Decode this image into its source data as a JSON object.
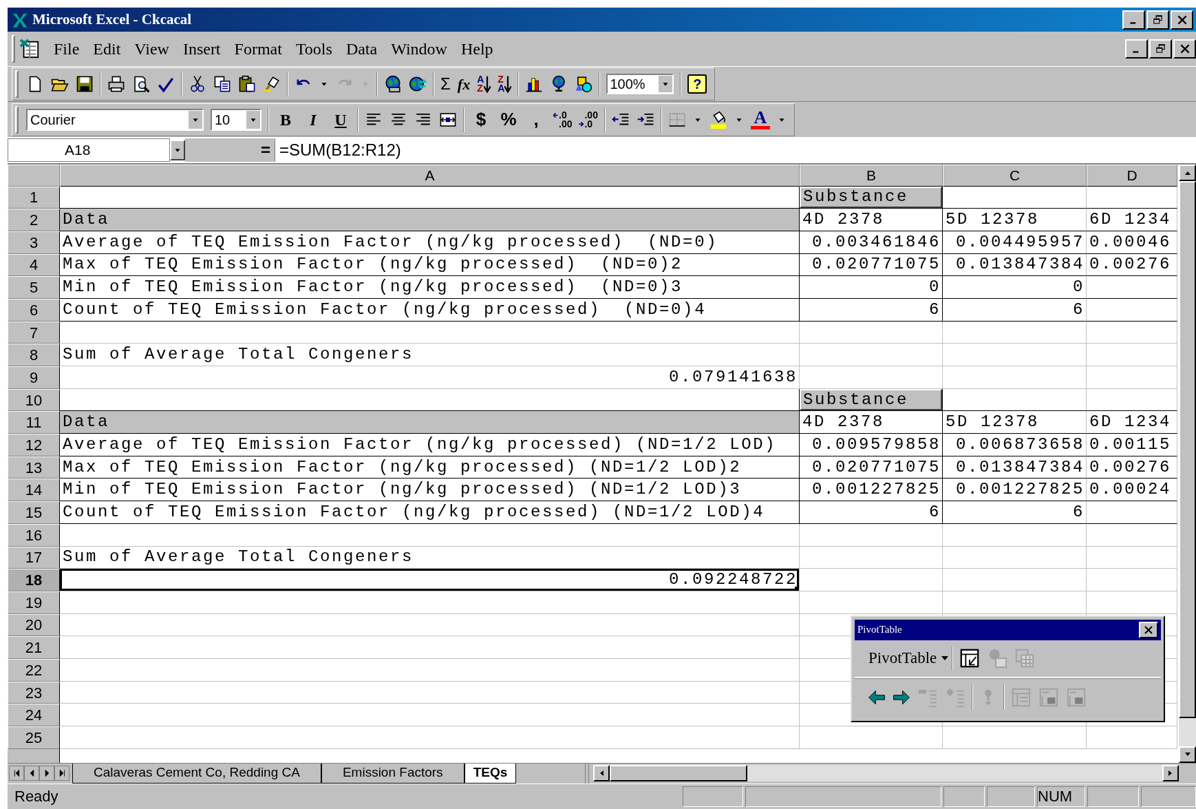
{
  "window": {
    "title": "Microsoft Excel - Ckcacal"
  },
  "menu": [
    "File",
    "Edit",
    "View",
    "Insert",
    "Format",
    "Tools",
    "Data",
    "Window",
    "Help"
  ],
  "standard_toolbar": {
    "autosum": "Σ",
    "function": "fx",
    "sort": [
      {
        "top": "A",
        "bottom": "Z"
      },
      {
        "top": "Z",
        "bottom": "A"
      }
    ],
    "zoom": "100%",
    "help": "?"
  },
  "formatting_toolbar": {
    "font": "Courier",
    "size": "10",
    "style_buttons": [
      "B",
      "I",
      "U"
    ],
    "number_buttons": [
      "$",
      "%",
      ","
    ],
    "decimal_buttons": [
      {
        "top": ".0",
        "bottom": ".00"
      },
      {
        "top": ".00",
        "bottom": ".0"
      }
    ],
    "font_color": "A"
  },
  "formula_bar": {
    "name_box": "A18",
    "equals": "=",
    "formula": "=SUM(B12:R12)"
  },
  "columns": [
    "A",
    "B",
    "C",
    "D"
  ],
  "rows": [
    {
      "number": "1",
      "selected": false,
      "framed": true,
      "cells": {
        "B": {
          "text": "Substance",
          "kind": "field"
        }
      }
    },
    {
      "number": "2",
      "selected": false,
      "framed": true,
      "cells": {
        "A": {
          "text": "Data",
          "kind": "label"
        },
        "B": {
          "text": "4D 2378",
          "kind": "text"
        },
        "C": {
          "text": "5D 12378",
          "kind": "text"
        },
        "D": {
          "text": "6D 1234",
          "kind": "text"
        }
      }
    },
    {
      "number": "3",
      "selected": false,
      "framed": true,
      "cells": {
        "A": {
          "text": "Average of TEQ Emission Factor (ng/kg processed)  (ND=0)",
          "kind": "text"
        },
        "B": {
          "text": "0.003461846",
          "kind": "number"
        },
        "C": {
          "text": "0.004495957",
          "kind": "number"
        },
        "D": {
          "text": "0.00046",
          "kind": "text"
        }
      }
    },
    {
      "number": "4",
      "selected": false,
      "framed": true,
      "cells": {
        "A": {
          "text": "Max of TEQ Emission Factor (ng/kg processed)  (ND=0)2",
          "kind": "text"
        },
        "B": {
          "text": "0.020771075",
          "kind": "number"
        },
        "C": {
          "text": "0.013847384",
          "kind": "number"
        },
        "D": {
          "text": "0.00276",
          "kind": "text"
        }
      }
    },
    {
      "number": "5",
      "selected": false,
      "framed": true,
      "cells": {
        "A": {
          "text": "Min of TEQ Emission Factor (ng/kg processed)  (ND=0)3",
          "kind": "text"
        },
        "B": {
          "text": "0",
          "kind": "number"
        },
        "C": {
          "text": "0",
          "kind": "number"
        }
      }
    },
    {
      "number": "6",
      "selected": false,
      "framed": true,
      "cells": {
        "A": {
          "text": "Count of TEQ Emission Factor (ng/kg processed)  (ND=0)4",
          "kind": "text"
        },
        "B": {
          "text": "6",
          "kind": "number"
        },
        "C": {
          "text": "6",
          "kind": "number"
        }
      }
    },
    {
      "number": "7",
      "selected": false,
      "framed": false,
      "cells": {}
    },
    {
      "number": "8",
      "selected": false,
      "framed": false,
      "cells": {
        "A": {
          "text": "Sum of Average Total Congeners",
          "kind": "text"
        }
      }
    },
    {
      "number": "9",
      "selected": false,
      "framed": false,
      "cells": {
        "A": {
          "text": "0.079141638",
          "kind": "number"
        }
      }
    },
    {
      "number": "10",
      "selected": false,
      "framed": true,
      "cells": {
        "B": {
          "text": "Substance",
          "kind": "field"
        }
      }
    },
    {
      "number": "11",
      "selected": false,
      "framed": true,
      "cells": {
        "A": {
          "text": "Data",
          "kind": "label"
        },
        "B": {
          "text": "4D 2378",
          "kind": "text"
        },
        "C": {
          "text": "5D 12378",
          "kind": "text"
        },
        "D": {
          "text": "6D 1234",
          "kind": "text"
        }
      }
    },
    {
      "number": "12",
      "selected": false,
      "framed": true,
      "cells": {
        "A": {
          "text": "Average of TEQ Emission Factor (ng/kg processed) (ND=1/2 LOD)",
          "kind": "text"
        },
        "B": {
          "text": "0.009579858",
          "kind": "number"
        },
        "C": {
          "text": "0.006873658",
          "kind": "number"
        },
        "D": {
          "text": "0.00115",
          "kind": "text"
        }
      }
    },
    {
      "number": "13",
      "selected": false,
      "framed": true,
      "cells": {
        "A": {
          "text": "Max of TEQ Emission Factor (ng/kg processed) (ND=1/2 LOD)2",
          "kind": "text"
        },
        "B": {
          "text": "0.020771075",
          "kind": "number"
        },
        "C": {
          "text": "0.013847384",
          "kind": "number"
        },
        "D": {
          "text": "0.00276",
          "kind": "text"
        }
      }
    },
    {
      "number": "14",
      "selected": false,
      "framed": true,
      "cells": {
        "A": {
          "text": "Min of TEQ Emission Factor (ng/kg processed) (ND=1/2 LOD)3",
          "kind": "text"
        },
        "B": {
          "text": "0.001227825",
          "kind": "number"
        },
        "C": {
          "text": "0.001227825",
          "kind": "number"
        },
        "D": {
          "text": "0.00024",
          "kind": "text"
        }
      }
    },
    {
      "number": "15",
      "selected": false,
      "framed": true,
      "cells": {
        "A": {
          "text": "Count of TEQ Emission Factor (ng/kg processed) (ND=1/2 LOD)4",
          "kind": "text"
        },
        "B": {
          "text": "6",
          "kind": "number"
        },
        "C": {
          "text": "6",
          "kind": "number"
        }
      }
    },
    {
      "number": "16",
      "selected": false,
      "framed": false,
      "cells": {}
    },
    {
      "number": "17",
      "selected": false,
      "framed": false,
      "cells": {
        "A": {
          "text": "Sum of Average Total Congeners",
          "kind": "text"
        }
      }
    },
    {
      "number": "18",
      "selected": true,
      "framed": false,
      "cells": {
        "A": {
          "text": "0.092248722",
          "kind": "number",
          "active": true
        }
      }
    },
    {
      "number": "19",
      "selected": false,
      "framed": false,
      "cells": {}
    },
    {
      "number": "20",
      "selected": false,
      "framed": false,
      "cells": {}
    },
    {
      "number": "21",
      "selected": false,
      "framed": false,
      "cells": {}
    },
    {
      "number": "22",
      "selected": false,
      "framed": false,
      "cells": {}
    },
    {
      "number": "23",
      "selected": false,
      "framed": false,
      "cells": {}
    },
    {
      "number": "24",
      "selected": false,
      "framed": false,
      "cells": {}
    },
    {
      "number": "25",
      "selected": false,
      "framed": false,
      "cells": {}
    }
  ],
  "pivot_toolbar": {
    "title": "PivotTable",
    "menu": "PivotTable"
  },
  "sheet_tabs": [
    {
      "label": "Calaveras Cement Co, Redding CA",
      "selected": false
    },
    {
      "label": "Emission Factors",
      "selected": false
    },
    {
      "label": "TEQs",
      "selected": true
    }
  ],
  "status_bar": {
    "text": "Ready",
    "indicators": [
      "NUM"
    ]
  }
}
